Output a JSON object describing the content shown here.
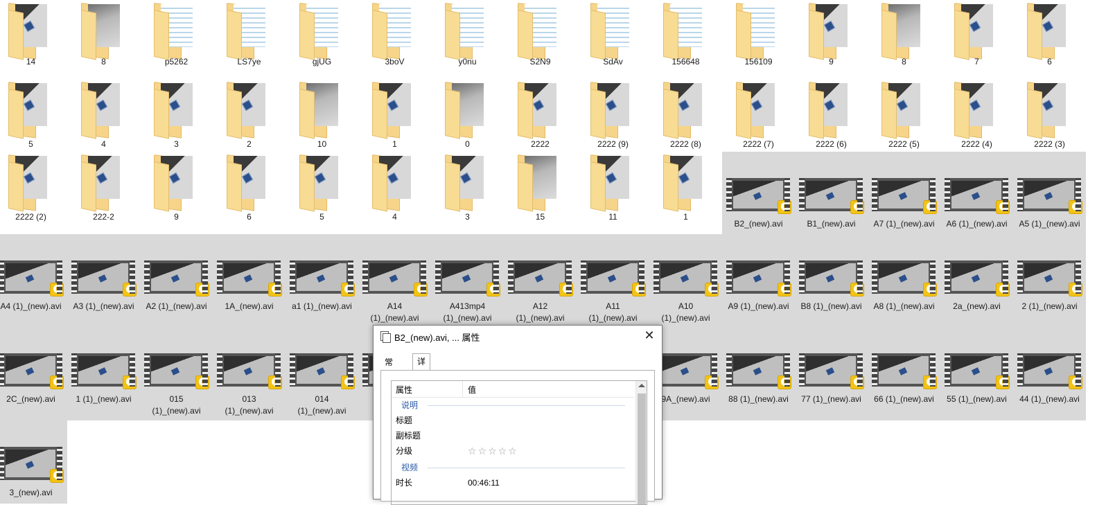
{
  "explorer": {
    "items": [
      {
        "kind": "folder",
        "style": "photo",
        "label": "14"
      },
      {
        "kind": "folder",
        "style": "gray",
        "label": "8"
      },
      {
        "kind": "folder",
        "style": "doc",
        "label": "p5262"
      },
      {
        "kind": "folder",
        "style": "doc",
        "label": "LS7ye"
      },
      {
        "kind": "folder",
        "style": "doc",
        "label": "gjUG"
      },
      {
        "kind": "folder",
        "style": "doc",
        "label": "3boV"
      },
      {
        "kind": "folder",
        "style": "doc",
        "label": "y0nu"
      },
      {
        "kind": "folder",
        "style": "doc",
        "label": "S2N9"
      },
      {
        "kind": "folder",
        "style": "doc",
        "label": "SdAv"
      },
      {
        "kind": "folder",
        "style": "doc",
        "label": "156648"
      },
      {
        "kind": "folder",
        "style": "doc",
        "label": "156109"
      },
      {
        "kind": "folder",
        "style": "photo",
        "label": "9"
      },
      {
        "kind": "folder",
        "style": "gray",
        "label": "8"
      },
      {
        "kind": "folder",
        "style": "photo",
        "label": "7"
      },
      {
        "kind": "folder",
        "style": "photo",
        "label": "6"
      },
      {
        "kind": "folder",
        "style": "photo",
        "label": "5"
      },
      {
        "kind": "folder",
        "style": "photo",
        "label": "4"
      },
      {
        "kind": "folder",
        "style": "photo",
        "label": "3"
      },
      {
        "kind": "folder",
        "style": "photo",
        "label": "2"
      },
      {
        "kind": "folder",
        "style": "gray",
        "label": "10"
      },
      {
        "kind": "folder",
        "style": "photo",
        "label": "1"
      },
      {
        "kind": "folder",
        "style": "gray",
        "label": "0"
      },
      {
        "kind": "folder",
        "style": "photo",
        "label": "2222"
      },
      {
        "kind": "folder",
        "style": "photo",
        "label": "2222 (9)"
      },
      {
        "kind": "folder",
        "style": "photo",
        "label": "2222 (8)"
      },
      {
        "kind": "folder",
        "style": "photo",
        "label": "2222 (7)"
      },
      {
        "kind": "folder",
        "style": "photo",
        "label": "2222 (6)"
      },
      {
        "kind": "folder",
        "style": "photo",
        "label": "2222 (5)"
      },
      {
        "kind": "folder",
        "style": "photo",
        "label": "2222 (4)"
      },
      {
        "kind": "folder",
        "style": "photo",
        "label": "2222 (3)"
      },
      {
        "kind": "folder",
        "style": "photo",
        "label": "2222 (2)"
      },
      {
        "kind": "folder",
        "style": "photo",
        "label": "222-2"
      },
      {
        "kind": "folder",
        "style": "photo",
        "label": "9"
      },
      {
        "kind": "folder",
        "style": "photo",
        "label": "6"
      },
      {
        "kind": "folder",
        "style": "photo",
        "label": "5"
      },
      {
        "kind": "folder",
        "style": "photo",
        "label": "4"
      },
      {
        "kind": "folder",
        "style": "photo",
        "label": "3"
      },
      {
        "kind": "folder",
        "style": "gray",
        "label": "15"
      },
      {
        "kind": "folder",
        "style": "photo",
        "label": "11"
      },
      {
        "kind": "folder",
        "style": "photo",
        "label": "1"
      },
      {
        "kind": "video",
        "label": "B2_(new).avi"
      },
      {
        "kind": "video",
        "label": "B1_(new).avi"
      },
      {
        "kind": "video",
        "label": "A7 (1)_(new).avi"
      },
      {
        "kind": "video",
        "label": "A6 (1)_(new).avi"
      },
      {
        "kind": "video",
        "label": "A5 (1)_(new).avi"
      },
      {
        "kind": "video",
        "label": "A4 (1)_(new).avi"
      },
      {
        "kind": "video",
        "label": "A3 (1)_(new).avi"
      },
      {
        "kind": "video",
        "label": "A2 (1)_(new).avi"
      },
      {
        "kind": "video",
        "label": "1A_(new).avi"
      },
      {
        "kind": "video",
        "label": "a1 (1)_(new).avi"
      },
      {
        "kind": "video",
        "label": "A14\n(1)_(new).avi"
      },
      {
        "kind": "video",
        "label": "A413mp4\n(1)_(new).avi"
      },
      {
        "kind": "video",
        "label": "A12\n(1)_(new).avi"
      },
      {
        "kind": "video",
        "label": "A11\n(1)_(new).avi"
      },
      {
        "kind": "video",
        "label": "A10\n(1)_(new).avi"
      },
      {
        "kind": "video",
        "label": "A9 (1)_(new).avi"
      },
      {
        "kind": "video",
        "label": "B8 (1)_(new).avi"
      },
      {
        "kind": "video",
        "label": "A8 (1)_(new).avi"
      },
      {
        "kind": "video",
        "label": "2a_(new).avi"
      },
      {
        "kind": "video",
        "label": "2 (1)_(new).avi"
      },
      {
        "kind": "video",
        "label": "2C_(new).avi"
      },
      {
        "kind": "video",
        "label": "1 (1)_(new).avi"
      },
      {
        "kind": "video",
        "label": "015\n(1)_(new).avi"
      },
      {
        "kind": "video",
        "label": "013\n(1)_(new).avi"
      },
      {
        "kind": "video",
        "label": "014\n(1)_(new).avi"
      },
      {
        "kind": "video",
        "label": ""
      },
      {
        "kind": "video",
        "label": ""
      },
      {
        "kind": "video",
        "label": ""
      },
      {
        "kind": "video",
        "label": ""
      },
      {
        "kind": "video",
        "label": "9A_(new).avi"
      },
      {
        "kind": "video",
        "label": "88 (1)_(new).avi"
      },
      {
        "kind": "video",
        "label": "77 (1)_(new).avi"
      },
      {
        "kind": "video",
        "label": "66 (1)_(new).avi"
      },
      {
        "kind": "video",
        "label": "55 (1)_(new).avi"
      },
      {
        "kind": "video",
        "label": "44 (1)_(new).avi"
      },
      {
        "kind": "video",
        "label": "3_(new).avi"
      }
    ]
  },
  "dialog": {
    "title": "B2_(new).avi, ... 属性",
    "close_glyph": "✕",
    "tabs": [
      "常规",
      "详细信息"
    ],
    "header_property": "属性",
    "header_value": "值",
    "group_description": "说明",
    "title_label": "标题",
    "subtitle_label": "副标题",
    "rating_label": "分级",
    "rating_stars": "☆☆☆☆☆",
    "group_video": "视频",
    "duration_label": "时长",
    "duration_value": "00:46:11"
  }
}
